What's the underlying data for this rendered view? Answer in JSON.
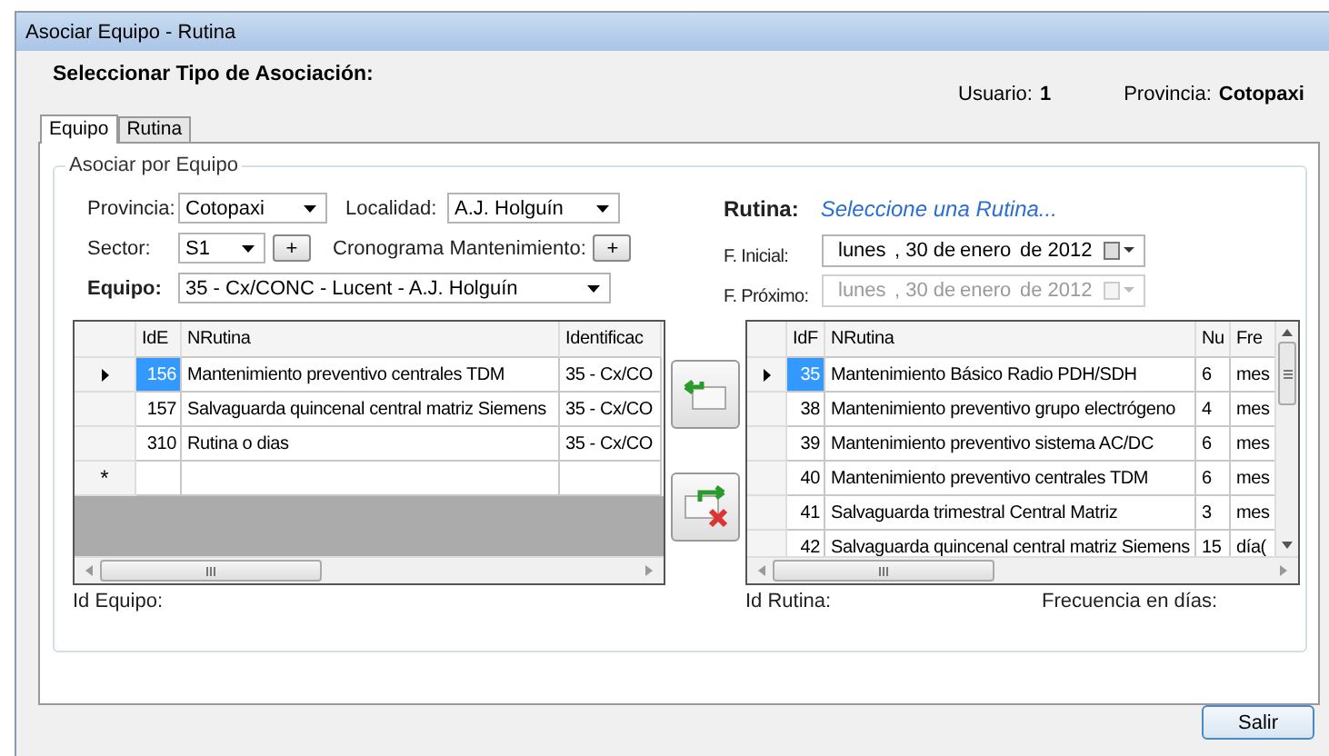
{
  "window": {
    "title": "Asociar Equipo - Rutina"
  },
  "header": {
    "title": "Seleccionar Tipo de Asociación:",
    "user_label": "Usuario:",
    "user_value": "1",
    "province_label": "Provincia:",
    "province_value": "Cotopaxi"
  },
  "tabs": [
    {
      "label": "Equipo",
      "selected": true
    },
    {
      "label": "Rutina",
      "selected": false
    }
  ],
  "group": {
    "title": "Asociar por Equipo"
  },
  "form": {
    "provincia": {
      "label": "Provincia:",
      "value": "Cotopaxi"
    },
    "localidad": {
      "label": "Localidad:",
      "value": "A.J. Holguín"
    },
    "sector": {
      "label": "Sector:",
      "value": "S1",
      "button": "+"
    },
    "cronograma": {
      "label": "Cronograma Mantenimiento:",
      "button": "+"
    },
    "equipo": {
      "label": "Equipo:",
      "value": "35 - Cx/CONC - Lucent - A.J. Holguín"
    }
  },
  "rutina": {
    "label": "Rutina:",
    "link": "Seleccione una Rutina...",
    "dates": [
      {
        "label": "F. Inicial:",
        "day": "lunes",
        "date": ", 30 de",
        "month": "enero",
        "year": "de 2012",
        "disabled": false
      },
      {
        "label": "F. Próximo:",
        "day": "lunes",
        "date": ", 30 de",
        "month": "enero",
        "year": "de 2012",
        "disabled": true
      }
    ]
  },
  "left_table": {
    "columns": [
      "IdE",
      "NRutina",
      "Identificac"
    ],
    "rows": [
      {
        "cells": [
          "156",
          "Mantenimiento preventivo centrales TDM",
          "35 - Cx/CO"
        ],
        "current": true
      },
      {
        "cells": [
          "157",
          "Salvaguarda quincenal central matriz Siemens",
          "35 - Cx/CO"
        ],
        "current": false
      },
      {
        "cells": [
          "310",
          "Rutina o dias",
          "35 - Cx/CO"
        ],
        "current": false
      }
    ],
    "new_row_marker": "*"
  },
  "transfer_buttons": [
    {
      "kind": "add"
    },
    {
      "kind": "remove"
    }
  ],
  "right_table": {
    "columns": [
      "IdF",
      "NRutina",
      "Nu",
      "Fre"
    ],
    "rows": [
      {
        "cells": [
          "35",
          "Mantenimiento Básico Radio PDH/SDH",
          "6",
          "mes"
        ],
        "current": true
      },
      {
        "cells": [
          "38",
          "Mantenimiento preventivo grupo electrógeno",
          "4",
          "mes"
        ],
        "current": false
      },
      {
        "cells": [
          "39",
          "Mantenimiento preventivo sistema AC/DC",
          "6",
          "mes"
        ],
        "current": false
      },
      {
        "cells": [
          "40",
          "Mantenimiento preventivo centrales TDM",
          "6",
          "mes"
        ],
        "current": false
      },
      {
        "cells": [
          "41",
          "Salvaguarda trimestral Central Matriz",
          "3",
          "mes"
        ],
        "current": false
      },
      {
        "cells": [
          "42",
          "Salvaguarda quincenal central matriz Siemens",
          "15",
          "día("
        ],
        "current": false
      }
    ]
  },
  "footer": {
    "id_equipo": "Id Equipo:",
    "id_rutina": "Id Rutina:",
    "frecuencia": "Frecuencia en días:"
  },
  "buttons": [
    "Salir"
  ]
}
